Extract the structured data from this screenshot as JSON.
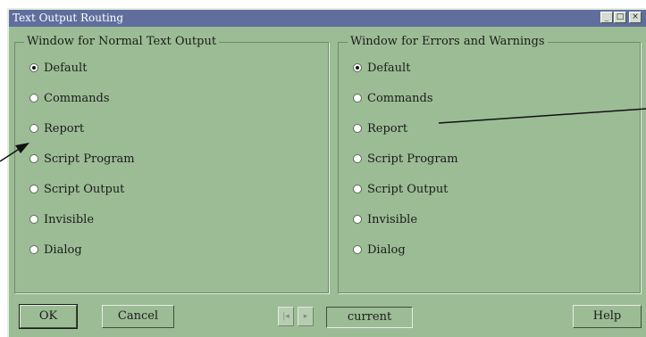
{
  "window": {
    "title": "Text Output Routing",
    "controls": {
      "minimize": "_",
      "maximize": "□",
      "close": "×"
    }
  },
  "groups": {
    "normal": {
      "title": "Window for Normal Text Output",
      "options": [
        {
          "label": "Default",
          "selected": true
        },
        {
          "label": "Commands",
          "selected": false
        },
        {
          "label": "Report",
          "selected": false
        },
        {
          "label": "Script Program",
          "selected": false
        },
        {
          "label": "Script Output",
          "selected": false
        },
        {
          "label": "Invisible",
          "selected": false
        },
        {
          "label": "Dialog",
          "selected": false
        }
      ]
    },
    "errors": {
      "title": "Window for Errors and Warnings",
      "options": [
        {
          "label": "Default",
          "selected": true
        },
        {
          "label": "Commands",
          "selected": false
        },
        {
          "label": "Report",
          "selected": false
        },
        {
          "label": "Script Program",
          "selected": false
        },
        {
          "label": "Script Output",
          "selected": false
        },
        {
          "label": "Invisible",
          "selected": false
        },
        {
          "label": "Dialog",
          "selected": false
        }
      ]
    }
  },
  "buttons": {
    "ok": "OK",
    "cancel": "Cancel",
    "help": "Help"
  },
  "nav": {
    "prev_icon": "step-back-icon",
    "next_icon": "step-forward-icon",
    "current": "current"
  },
  "colors": {
    "dialog_bg": "#9cbc95",
    "titlebar_bg": "#5f6e9d"
  }
}
